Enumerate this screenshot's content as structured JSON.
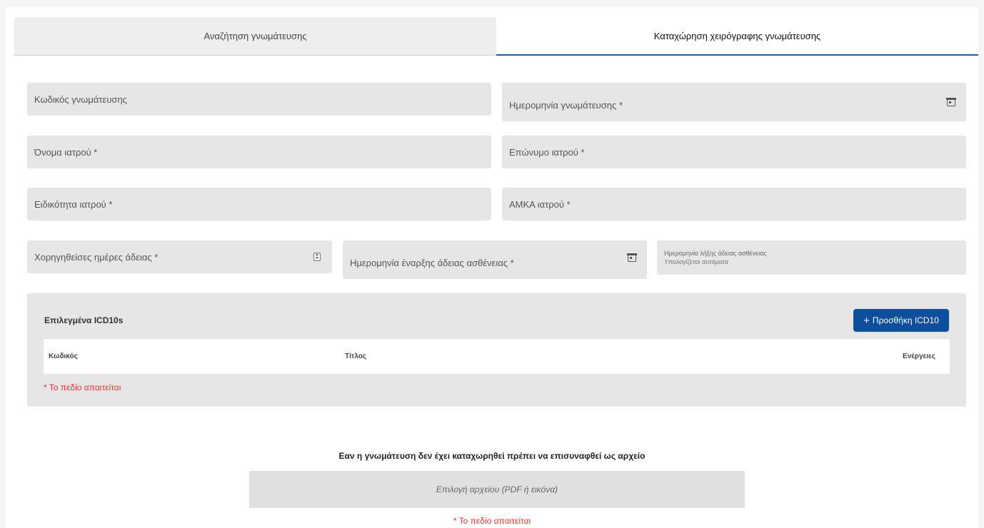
{
  "tabs": [
    {
      "label": "Αναζήτηση γνωμάτευσης"
    },
    {
      "label": "Καταχώρηση χειρόγραφης γνωμάτευσης"
    }
  ],
  "form": {
    "code_label": "Κωδικός γνωμάτευσης",
    "date_label": "Ημερομηνία γνωμάτευσης *",
    "first_name_label": "Όνομα ιατρού *",
    "last_name_label": "Επώνυμο ιατρού *",
    "specialty_label": "Ειδικότητα ιατρού *",
    "amka_label": "ΑΜΚΑ ιατρού *",
    "days_label": "Χορηγηθείσες ημέρες άδειας *",
    "start_date_label": "Ημερομηνία έναρξης άδειας ασθένειας *",
    "end_date_label": "Ημερομηνία λήξης άδειας ασθένειας",
    "end_date_hint": "Υπολογίζεται αυτόματα"
  },
  "icd": {
    "title": "Επιλεγμένα ICD10s",
    "add_button": "Προσθήκη ICD10",
    "add_plus": "+",
    "columns": {
      "code": "Κωδικός",
      "title": "Τίτλος",
      "actions": "Ενέργειες"
    },
    "required_error": "* Το πεδίο απαιτείται"
  },
  "upload": {
    "note": "Εαν η γνωμάτευση δεν έχει καταχωρηθεί πρέπει να επισυναφθεί ως αρχείο",
    "button": "Επιλογή αρχείου (PDF ή εικόνα)",
    "required_error": "* Το πεδίο απαιτείται"
  },
  "icons": {
    "calendar": "calendar-icon",
    "stepper": "stepper-icon"
  },
  "colors": {
    "accent": "#0d4f9c",
    "error": "#e53935",
    "field_bg": "#e6e6e6"
  }
}
